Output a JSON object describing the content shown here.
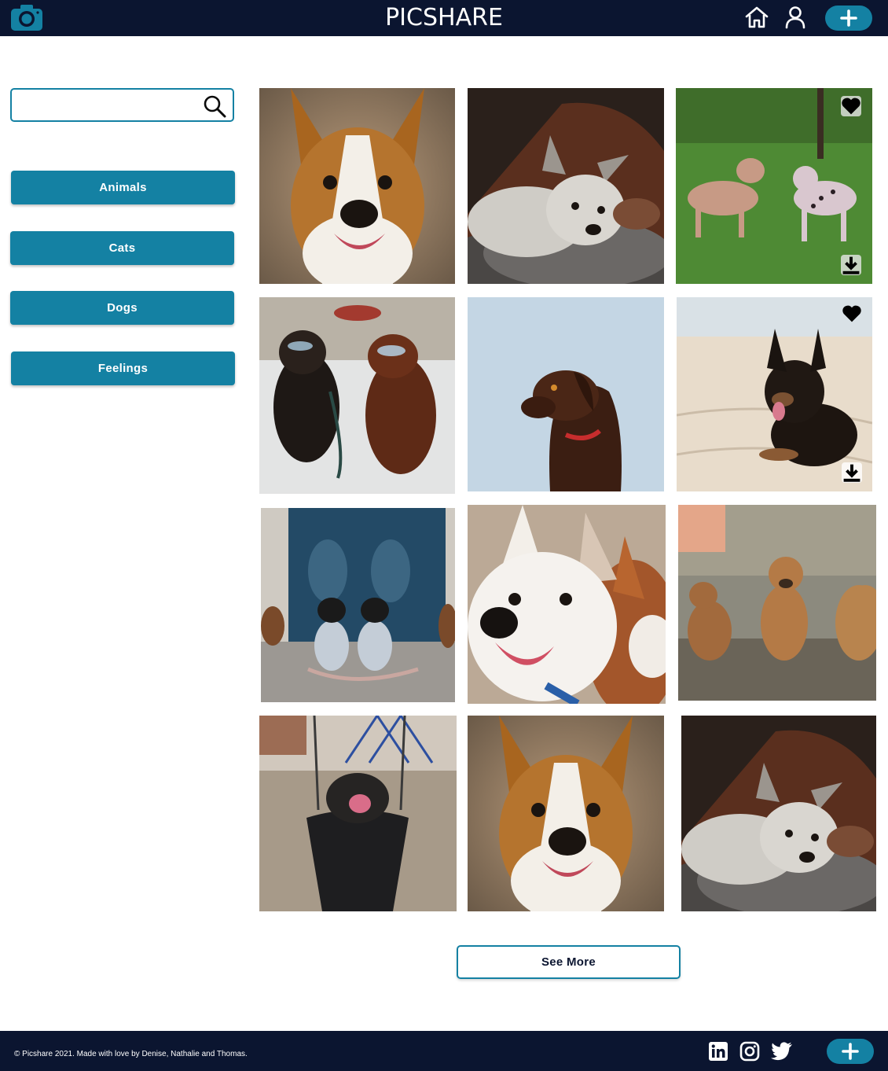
{
  "header": {
    "brand": "PICSHARE",
    "accent": "#1481a3",
    "bg": "#0b1530"
  },
  "sidebar": {
    "search_placeholder": "",
    "categories": [
      {
        "label": "Animals"
      },
      {
        "label": "Cats"
      },
      {
        "label": "Dogs"
      },
      {
        "label": "Feelings"
      }
    ]
  },
  "gallery": {
    "photos": [
      {
        "subject": "smiling brown-white dog close-up"
      },
      {
        "subject": "husky puppy on leather couch"
      },
      {
        "subject": "two dogs on grass",
        "liked": true,
        "downloadable": true
      },
      {
        "subject": "two poodles with sunglasses"
      },
      {
        "subject": "chocolate labrador on blue background"
      },
      {
        "subject": "german shepherd on sand",
        "liked": true,
        "downloadable": true
      },
      {
        "subject": "two boston terriers in sweaters"
      },
      {
        "subject": "two corgis smiling"
      },
      {
        "subject": "three puppies outdoors"
      },
      {
        "subject": "french bulldog in swing"
      },
      {
        "subject": "smiling brown-white dog close-up"
      },
      {
        "subject": "husky puppy on leather couch"
      }
    ],
    "see_more_label": "See More"
  },
  "footer": {
    "copyright": "© Picshare 2021. Made with love by Denise, Nathalie and Thomas."
  },
  "icons": {
    "logo": "camera-icon",
    "home": "home-icon",
    "user": "user-icon",
    "add": "plus-icon",
    "search": "search-icon",
    "like": "heart-icon",
    "download": "download-icon",
    "linkedin": "linkedin-icon",
    "instagram": "instagram-icon",
    "twitter": "twitter-icon"
  }
}
